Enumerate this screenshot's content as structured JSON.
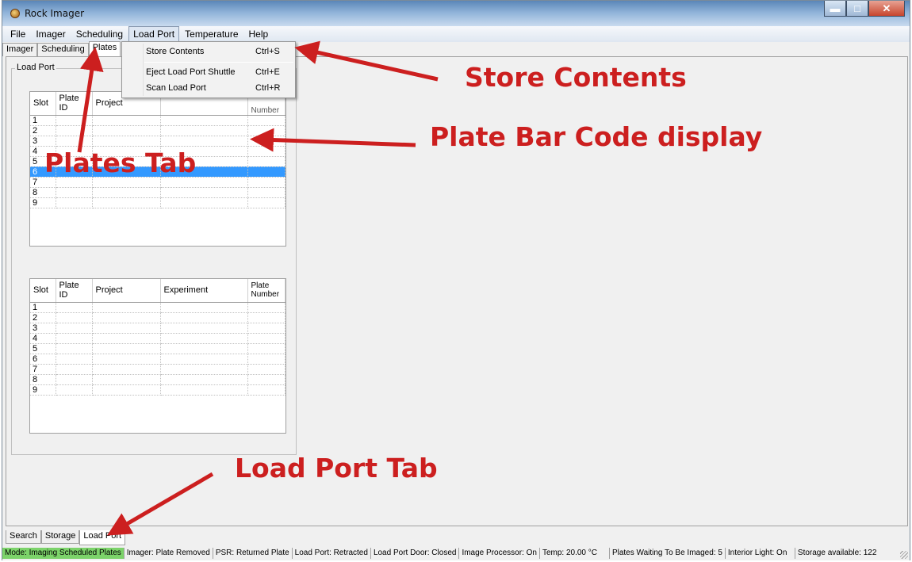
{
  "window": {
    "title": "Rock Imager",
    "buttons": {
      "minimize": "▬",
      "maximize": "□",
      "close": "✕"
    }
  },
  "menubar": {
    "items": [
      "File",
      "Imager",
      "Scheduling",
      "Load Port",
      "Temperature",
      "Help"
    ],
    "open_index": 3
  },
  "top_tabs": [
    "Imager",
    "Scheduling",
    "Plates"
  ],
  "load_port_menu": [
    {
      "label": "Store Contents",
      "shortcut": "Ctrl+S"
    },
    {
      "label": "Eject Load Port Shuttle",
      "shortcut": "Ctrl+E"
    },
    {
      "label": "Scan Load Port",
      "shortcut": "Ctrl+R"
    }
  ],
  "groupbox_label": "Load Port",
  "grid1": {
    "columns": [
      "Slot",
      "Plate ID",
      "Project",
      "",
      "Number"
    ],
    "rows": [
      "1",
      "2",
      "3",
      "4",
      "5",
      "6",
      "7",
      "8",
      "9"
    ],
    "selected_row": "6"
  },
  "grid2": {
    "columns": [
      "Slot",
      "Plate ID",
      "Project",
      "Experiment",
      "Plate Number"
    ],
    "rows": [
      "1",
      "2",
      "3",
      "4",
      "5",
      "6",
      "7",
      "8",
      "9"
    ]
  },
  "bottom_tabs": [
    "Search",
    "Storage",
    "Load Port"
  ],
  "status": {
    "mode": "Mode: Imaging Scheduled Plates",
    "imager": "Imager: Plate Removed",
    "psr": "PSR: Returned Plate",
    "load_port": "Load Port: Retracted",
    "door": "Load Port Door: Closed",
    "processor": "Image Processor: On",
    "temp": "Temp: 20.00 °C",
    "waiting": "Plates Waiting To Be Imaged: 5",
    "light": "Interior Light: On",
    "storage": "Storage available: 122"
  },
  "annotations": {
    "store_contents": "Store Contents",
    "plate_bar_code": "Plate Bar Code display",
    "plates_tab": "Plates Tab",
    "load_port_tab": "Load Port Tab"
  },
  "colors": {
    "annotation": "#cc1f1f",
    "selection": "#3399ff",
    "mode_status": "#7cd36a"
  }
}
